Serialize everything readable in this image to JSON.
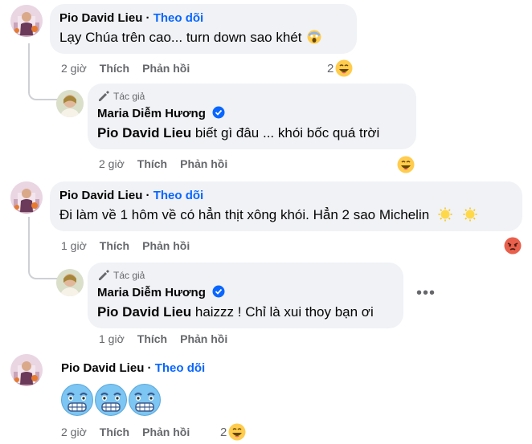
{
  "comments": [
    {
      "author": "Pio David Lieu",
      "follow": "Theo dõi",
      "text": "Lạy Chúa trên cao... turn down sao khét",
      "time": "2 giờ",
      "like": "Thích",
      "reply": "Phản hồi",
      "reaction_count": "2",
      "reaction": "laugh",
      "replies": [
        {
          "tag": "Tác giả",
          "author": "Maria Diễm Hương",
          "mention": "Pio David Lieu",
          "text": " biết gì đâu ... khói bốc quá trời",
          "time": "2 giờ",
          "like": "Thích",
          "reply": "Phản hồi",
          "reaction": "laugh"
        }
      ]
    },
    {
      "author": "Pio David Lieu",
      "follow": "Theo dõi",
      "text": "Đi làm về 1 hôm về có hẳn thịt xông khói. Hẳn 2 sao Michelin",
      "time": "1 giờ",
      "like": "Thích",
      "reply": "Phản hồi",
      "reaction": "angry",
      "replies": [
        {
          "tag": "Tác giả",
          "author": "Maria Diễm Hương",
          "mention": "Pio David Lieu",
          "text": " haizzz ! Chỉ là xui thoy bạn ơi",
          "time": "1 giờ",
          "like": "Thích",
          "reply": "Phản hồi"
        }
      ]
    },
    {
      "author": "Pio David Lieu",
      "follow": "Theo dõi",
      "emoji_only": [
        "cold-face",
        "cold-face",
        "cold-face"
      ],
      "time": "2 giờ",
      "like": "Thích",
      "reply": "Phản hồi",
      "reaction_count": "2",
      "reaction": "laugh"
    }
  ],
  "colors": {
    "link": "#0866ff",
    "bubble": "#f0f2f5",
    "meta": "#65676b",
    "verified": "#0866ff"
  }
}
